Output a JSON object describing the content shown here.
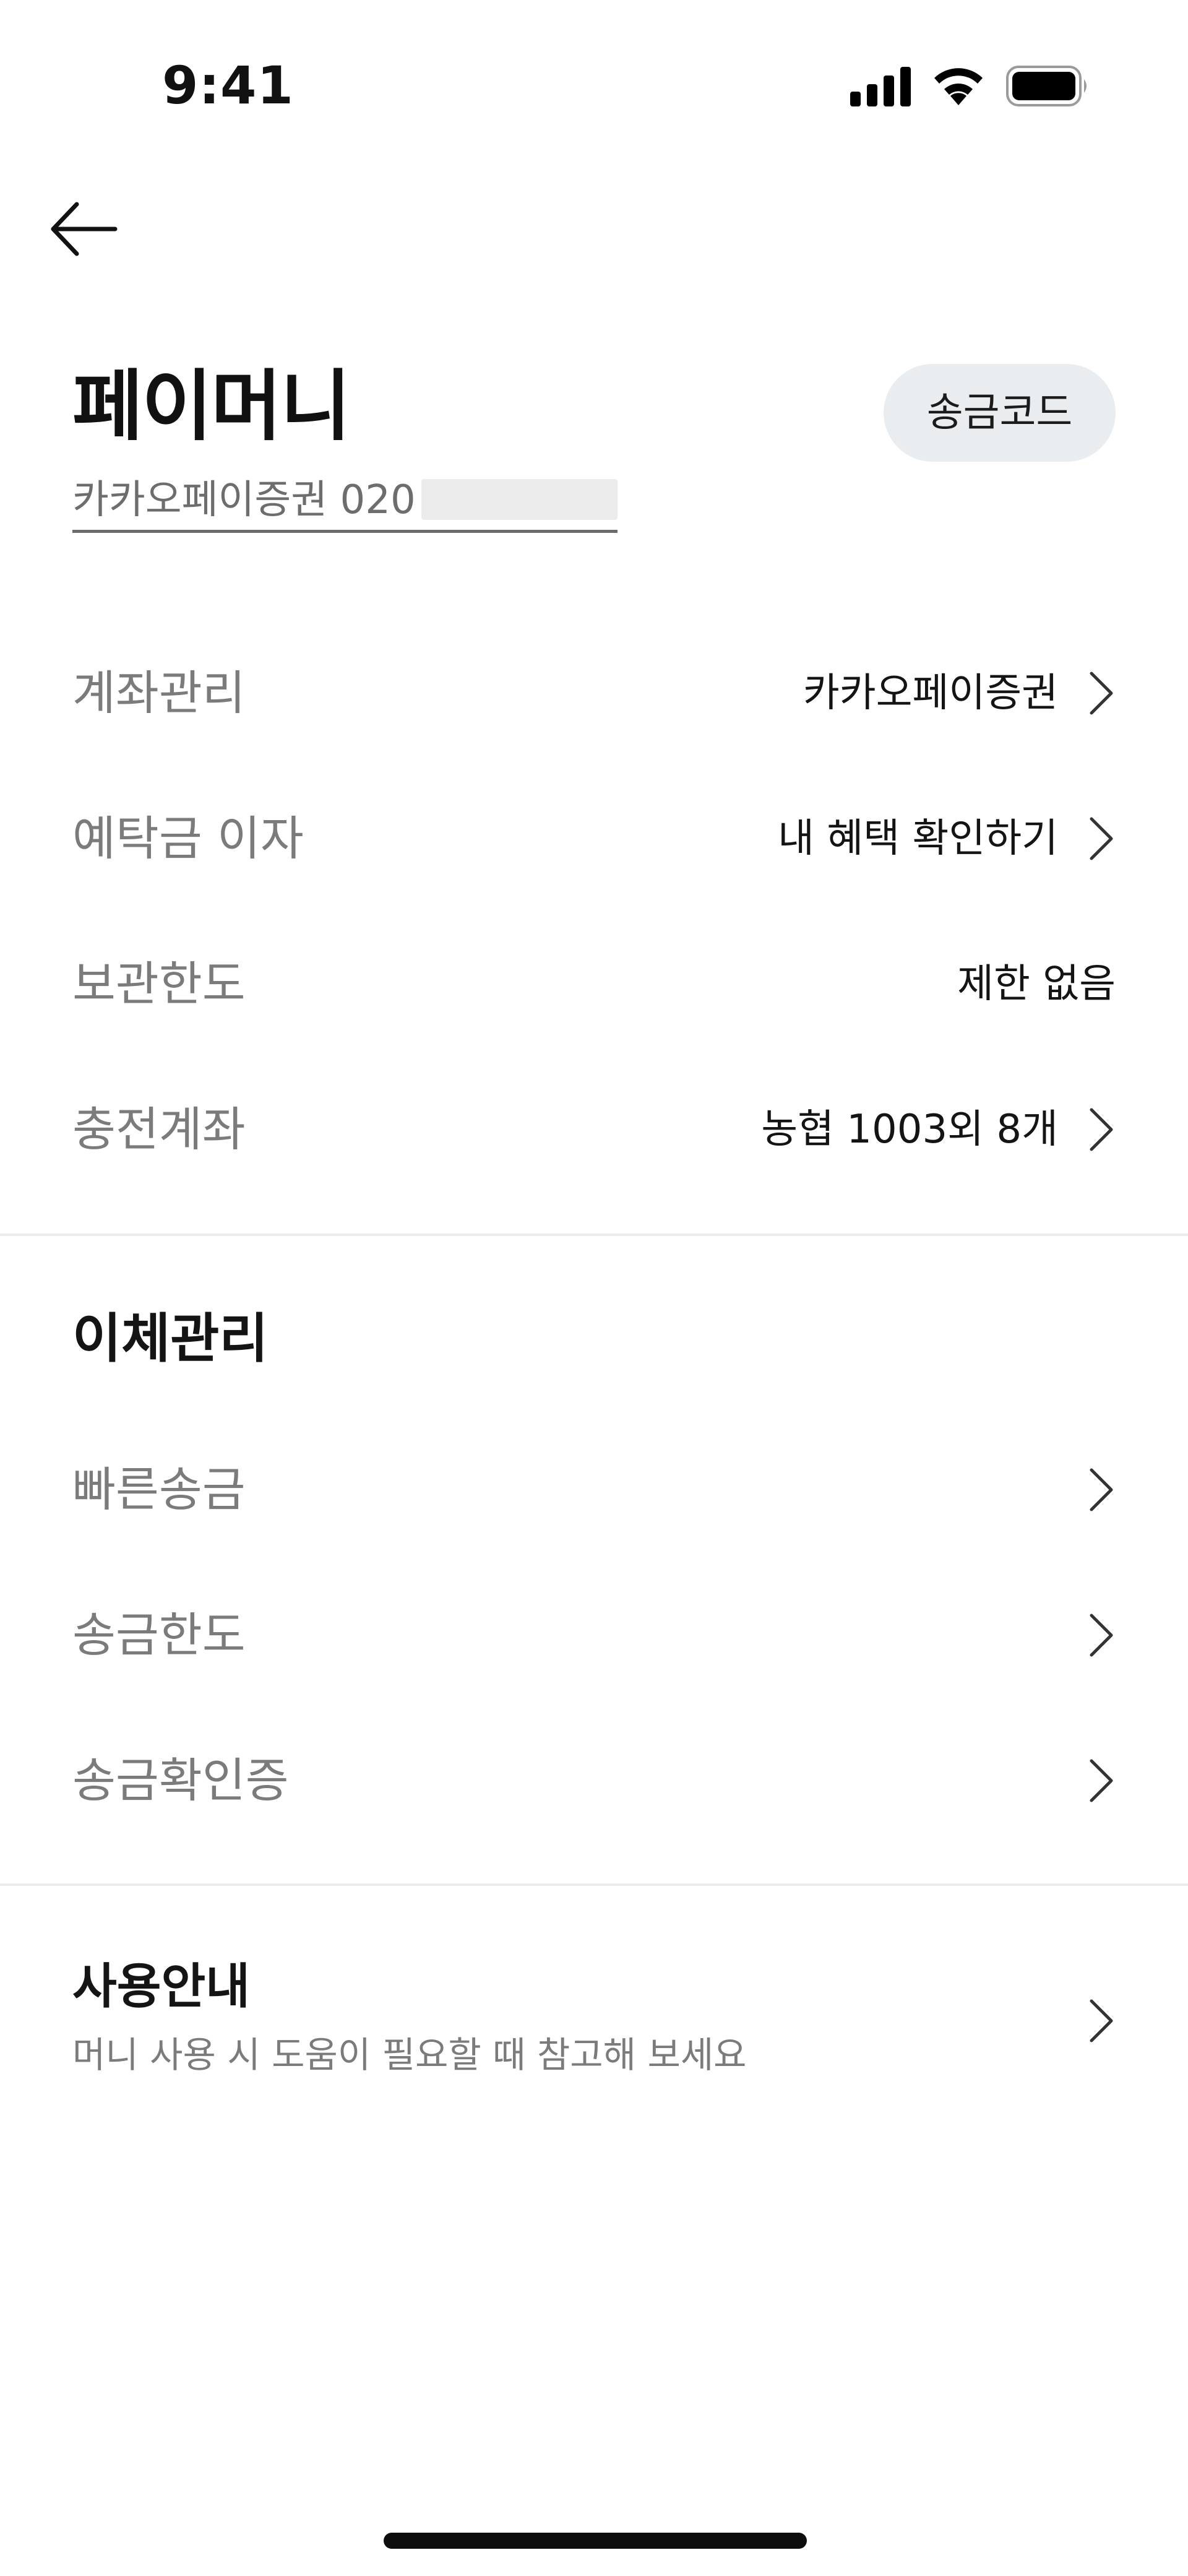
{
  "status_bar": {
    "time": "9:41"
  },
  "header": {
    "title": "페이머니",
    "remit_code_label": "송금코드",
    "account_text": "카카오페이증권 020"
  },
  "account_rows": [
    {
      "label": "계좌관리",
      "value": "카카오페이증권",
      "chevron": true
    },
    {
      "label": "예탁금 이자",
      "value": "내 혜택 확인하기",
      "chevron": true
    },
    {
      "label": "보관한도",
      "value": "제한 없음",
      "chevron": false
    },
    {
      "label": "충전계좌",
      "value": "농협 1003외 8개",
      "chevron": true
    }
  ],
  "transfer_section": {
    "title": "이체관리",
    "items": [
      {
        "label": "빠른송금"
      },
      {
        "label": "송금한도"
      },
      {
        "label": "송금확인증"
      }
    ]
  },
  "guide": {
    "title": "사용안내",
    "subtitle": "머니 사용 시 도움이 필요할 때 참고해 보세요"
  },
  "colors": {
    "button_bg": "#e9edf0",
    "label_gray": "#7b7b7b",
    "text_dark": "#141414",
    "divider": "#ededed"
  },
  "icons": {
    "back": "arrow-left-icon",
    "chevron": "chevron-right-icon",
    "signal": "cellular-signal-icon",
    "wifi": "wifi-icon",
    "battery": "battery-icon"
  }
}
